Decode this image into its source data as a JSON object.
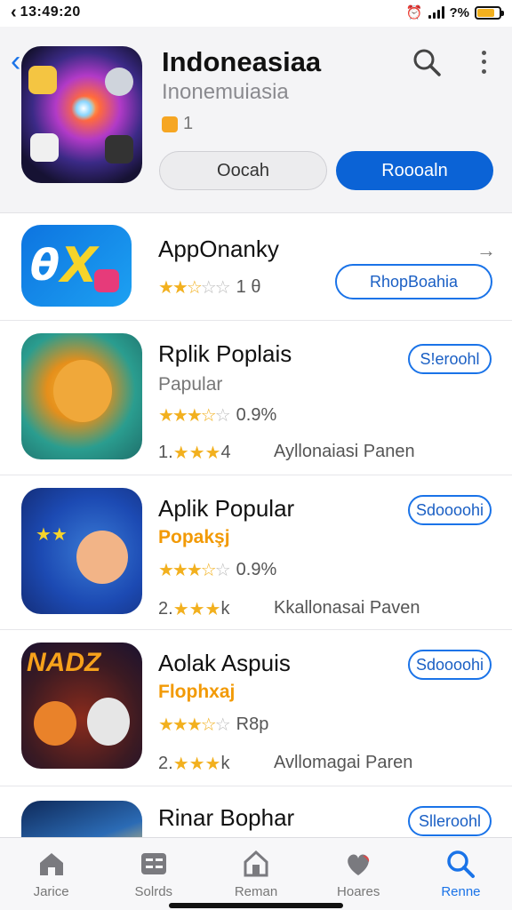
{
  "status": {
    "time": "13:49:20",
    "battery_level": 0.8,
    "signal": "4 bars",
    "battery_text": "?%"
  },
  "header": {
    "title": "Indoneasiaa",
    "subtitle": "Inonemuiasia",
    "rank": "1",
    "btn_secondary": "Oocah",
    "btn_primary": "Roooaln"
  },
  "apps": [
    {
      "name": "AppOnanky",
      "rating_value": "1 θ",
      "stars": 2.5,
      "button": "RhopBoahia"
    },
    {
      "name": "Rplik Poplais",
      "category": "Papular",
      "rating_value": "0.9%",
      "stars": 3.5,
      "rank": "1.",
      "rank_value": "4",
      "installs": "Ayllonaiasi Panen",
      "button": "S!eroohl"
    },
    {
      "name": "Aplik Popular",
      "category": "Popakşj",
      "rating_value": "0.9%",
      "stars": 3.5,
      "rank": "2.",
      "rank_value": "k",
      "installs": "Kkallonasai Paven",
      "button": "Sdoooohi"
    },
    {
      "name": "Aolak Aspuis",
      "category": "Flophxaj",
      "rating_value": "R8p",
      "stars": 3.5,
      "rank": "2.",
      "rank_value": "k",
      "installs": "Avllomagai Paren",
      "button": "Sdoooohi"
    },
    {
      "name": "Rinar Bophar",
      "button": "Slleroohl"
    }
  ],
  "tabs": [
    {
      "label": "Jarice",
      "icon": "home-icon"
    },
    {
      "label": "Solrds",
      "icon": "list-icon"
    },
    {
      "label": "Reman",
      "icon": "house-icon"
    },
    {
      "label": "Hoares",
      "icon": "heart-icon"
    },
    {
      "label": "Renne",
      "icon": "search-icon"
    }
  ],
  "colors": {
    "accent": "#1a73e8",
    "primary_button": "#0b63d6",
    "star": "#f2b01e",
    "battery": "#f2b01e"
  }
}
